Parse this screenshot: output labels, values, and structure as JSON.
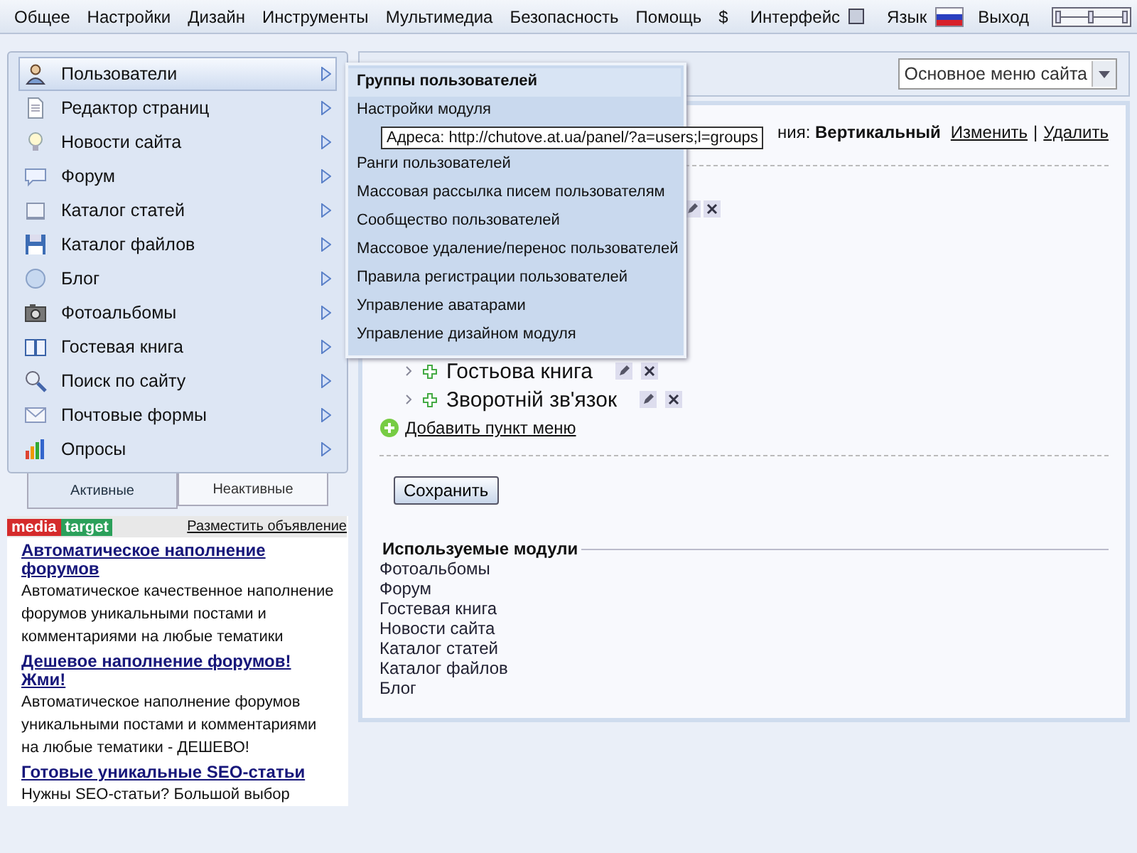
{
  "top_menu": [
    "Общее",
    "Настройки",
    "Дизайн",
    "Инструменты",
    "Мультимедиа",
    "Безопасность",
    "Помощь",
    "$"
  ],
  "top_right": {
    "interface_label": "Интерфейс",
    "interface_checked": false,
    "language_label": "Язык",
    "logout": "Выход"
  },
  "sidebar": {
    "items": [
      {
        "label": "Пользователи",
        "selected": true
      },
      {
        "label": "Редактор страниц",
        "selected": false
      },
      {
        "label": "Новости сайта",
        "selected": false
      },
      {
        "label": "Форум",
        "selected": false
      },
      {
        "label": "Каталог статей",
        "selected": false
      },
      {
        "label": "Каталог файлов",
        "selected": false
      },
      {
        "label": "Блог",
        "selected": false
      },
      {
        "label": "Фотоальбомы",
        "selected": false
      },
      {
        "label": "Гостевая книга",
        "selected": false
      },
      {
        "label": "Поиск по сайту",
        "selected": false
      },
      {
        "label": "Почтовые формы",
        "selected": false
      },
      {
        "label": "Опросы",
        "selected": false
      }
    ],
    "tabs": [
      {
        "label": "Активные",
        "selected": true
      },
      {
        "label": "Неактивные",
        "selected": false
      }
    ]
  },
  "ads": {
    "logo_left": "media",
    "logo_right": "target",
    "place_ad": "Разместить объявление",
    "items": [
      {
        "title": "Автоматическое наполнение форумов",
        "text": "Автоматическое качественное наполнение форумов уникальными постами и комментариями на любые тематики"
      },
      {
        "title": "Дешевое наполнение форумов! Жми!",
        "text": "Автоматическое наполнение форумов уникальными постами и комментариями на любые тематики - ДЕШЕВО!"
      },
      {
        "title": "Готовые уникальные SEO-статьи",
        "text": "Нужны SEO-статьи? Большой выбор"
      }
    ]
  },
  "submenu": {
    "items": [
      {
        "label": "Группы пользователей",
        "selected": true
      },
      {
        "label": "Настройки модуля",
        "selected": false
      },
      {
        "label": "Ранги пользователей",
        "selected": false
      },
      {
        "label": "Массовая рассылка писем пользователям",
        "selected": false
      },
      {
        "label": "Сообщество пользователей",
        "selected": false
      },
      {
        "label": "Массовое удаление/перенос пользователей",
        "selected": false
      },
      {
        "label": "Правила регистрации пользователей",
        "selected": false
      },
      {
        "label": "Управление аватарами",
        "selected": false
      },
      {
        "label": "Управление дизайном модуля",
        "selected": false
      }
    ]
  },
  "tooltip": "Адреса: http://chutove.at.ua/panel/?a=users;l=groups",
  "main": {
    "menu_select": "Основное меню сайта",
    "menu_type": "ния: **Вертикальный**",
    "edit_link": "Изменить",
    "separator": "|",
    "delete_link": "Удалить",
    "tree": [
      {
        "label": "Гостьова книга"
      },
      {
        "label": "Зворотній зв'язок"
      }
    ],
    "add_item": "Добавить пункт меню",
    "save": "Сохранить",
    "modules_title": "Используемые модули",
    "modules": [
      "Фотоальбомы",
      "Форум",
      "Гостевая книга",
      "Новости сайта",
      "Каталог статей",
      "Каталог файлов",
      "Блог"
    ]
  }
}
